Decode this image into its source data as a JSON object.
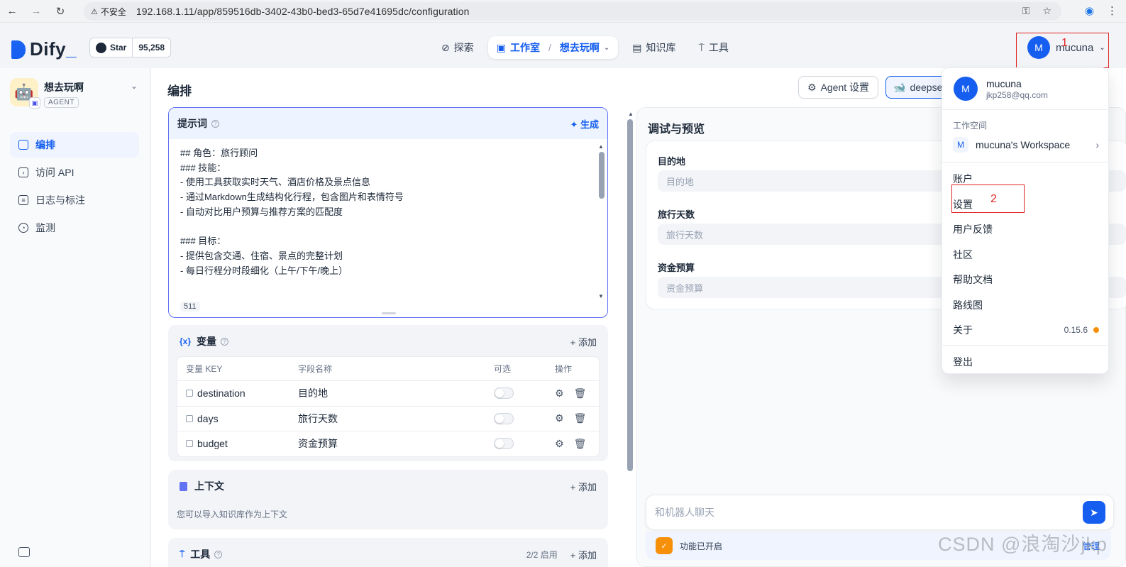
{
  "browser": {
    "security_label": "不安全",
    "url": "192.168.1.11/app/859516db-3402-43b0-bed3-65d7e41695dc/configuration"
  },
  "header": {
    "logo_text": "Dify",
    "github_star_label": "Star",
    "github_star_count": "95,258",
    "nav": {
      "explore": "探索",
      "studio": "工作室",
      "current_app": "想去玩啊",
      "knowledge": "知识库",
      "tools": "工具"
    },
    "user": {
      "avatar_letter": "M",
      "name": "mucuna"
    },
    "annotation_1": "1"
  },
  "sidebar": {
    "app_name": "想去玩啊",
    "app_type": "AGENT",
    "items": [
      {
        "label": "编排",
        "active": true
      },
      {
        "label": "访问 API"
      },
      {
        "label": "日志与标注"
      },
      {
        "label": "监测"
      }
    ]
  },
  "main": {
    "title": "编排",
    "agent_settings": "Agent 设置",
    "model_name": "deepseek",
    "prompt": {
      "title": "提示词",
      "generate": "生成",
      "content": "## 角色：旅行顾问\n### 技能：\n- 使用工具获取实时天气、酒店价格及景点信息\n- 通过Markdown生成结构化行程，包含图片和表情符号\n- 自动对比用户预算与推荐方案的匹配度\n\n### 目标：\n- 提供包含交通、住宿、景点的完整计划\n- 每日行程分时段细化（上午/下午/晚上）\n\n### 限制",
      "char_count": "511"
    },
    "variables": {
      "title": "变量",
      "add": "添加",
      "columns": [
        "变量 KEY",
        "字段名称",
        "可选",
        "操作"
      ],
      "rows": [
        {
          "key": "destination",
          "name": "目的地",
          "optional": false
        },
        {
          "key": "days",
          "name": "旅行天数",
          "optional": false
        },
        {
          "key": "budget",
          "name": "资金预算",
          "optional": false
        }
      ]
    },
    "context": {
      "title": "上下文",
      "add": "添加",
      "description": "您可以导入知识库作为上下文"
    },
    "tools": {
      "title": "工具",
      "count": "2/2 启用",
      "add": "添加"
    }
  },
  "debug": {
    "title": "调试与预览",
    "fields": [
      {
        "label": "目的地",
        "placeholder": "目的地"
      },
      {
        "label": "旅行天数",
        "placeholder": "旅行天数"
      },
      {
        "label": "资金预算",
        "placeholder": "资金预算"
      }
    ],
    "chat_placeholder": "和机器人聊天",
    "feature_status": "功能已开启",
    "manage": "管理"
  },
  "dropdown": {
    "avatar_letter": "M",
    "name": "mucuna",
    "email": "jkp258@qq.com",
    "workspace_label": "工作空间",
    "workspace_badge": "M",
    "workspace_name": "mucuna's Workspace",
    "items": {
      "account": "账户",
      "settings": "设置",
      "feedback": "用户反馈",
      "community": "社区",
      "docs": "帮助文档",
      "roadmap": "路线图",
      "about": "关于",
      "logout": "登出"
    },
    "version": "0.15.6",
    "annotation_2": "2"
  },
  "watermark": "CSDN @浪淘沙jkp",
  "colors": {
    "accent": "#155eef",
    "annotation": "#e02424",
    "version_dot": "#f79009"
  }
}
